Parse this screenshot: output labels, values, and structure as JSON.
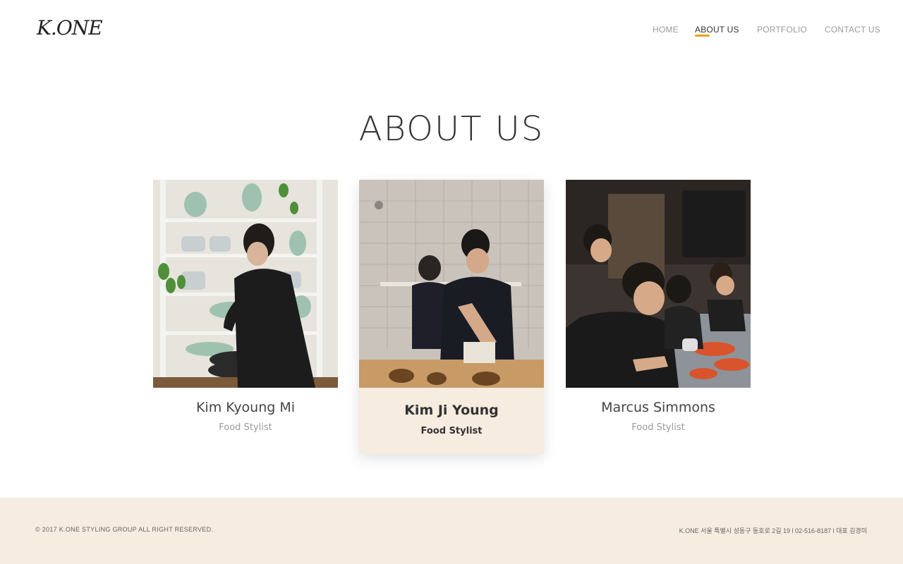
{
  "header": {
    "logo": "K.ONE",
    "nav": [
      {
        "label": "HOME"
      },
      {
        "label": "ABOUT US",
        "active": true
      },
      {
        "label": "PORTFOLIO"
      },
      {
        "label": "CONTACT US"
      }
    ]
  },
  "main": {
    "title": "ABOUT US",
    "members": [
      {
        "name": "Kim Kyoung Mi",
        "role": "Food Stylist"
      },
      {
        "name": "Kim Ji Young",
        "role": "Food Stylist"
      },
      {
        "name": "Marcus Simmons",
        "role": "Food Stylist"
      }
    ]
  },
  "footer": {
    "copyright": "© 2017 K.ONE STYLING GROUP ALL RIGHT RESERVED.",
    "address": "K.ONE 서울 특별시 성동구 동호로 2길 19 l 02-516-8187 l 대표 김경미"
  },
  "colors": {
    "accent": "#e8a317",
    "footer_bg": "#f6ece0",
    "highlight_card_bg": "#f6ece0"
  }
}
